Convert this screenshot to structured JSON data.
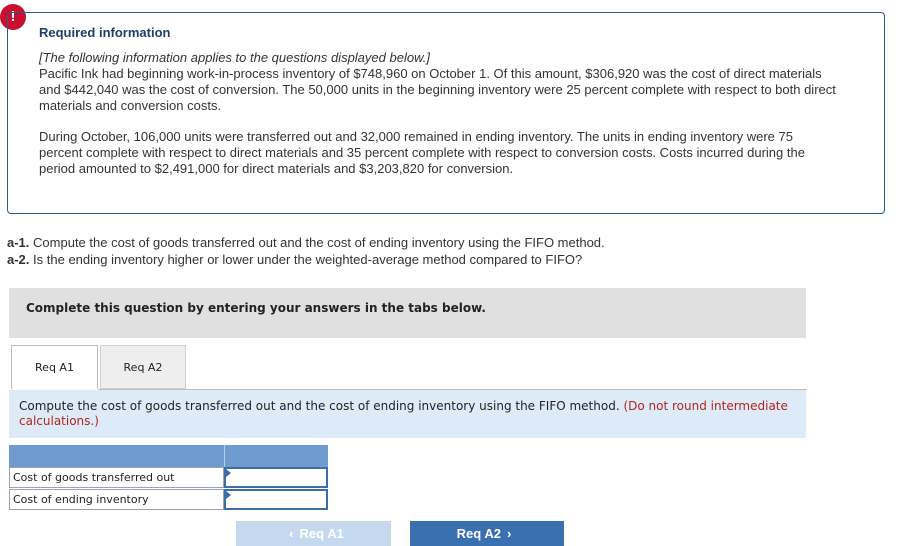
{
  "alert": {
    "icon": "!"
  },
  "info": {
    "title": "Required information",
    "intro_italic": "[The following information applies to the questions displayed below.]",
    "paragraph1": "Pacific Ink had beginning work-in-process inventory of $748,960 on October 1. Of this amount, $306,920 was the cost of direct materials and $442,040 was the cost of conversion. The 50,000 units in the beginning inventory were 25 percent complete with respect to both direct materials and conversion costs.",
    "paragraph2": "During October, 106,000 units were transferred out and 32,000 remained in ending inventory. The units in ending inventory were 75 percent complete with respect to direct materials and 35 percent complete with respect to conversion costs. Costs incurred during the period amounted to $2,491,000 for direct materials and $3,203,820 for conversion."
  },
  "questions": [
    {
      "label": "a-1.",
      "text": "Compute the cost of goods transferred out and the cost of ending inventory using the FIFO method."
    },
    {
      "label": "a-2.",
      "text": "Is the ending inventory higher or lower under the weighted-average method compared to FIFO?"
    }
  ],
  "instruction": "Complete this question by entering your answers in the tabs below.",
  "tabs": [
    {
      "label": "Req A1"
    },
    {
      "label": "Req A2"
    }
  ],
  "prompt": {
    "text": "Compute the cost of goods transferred out and the cost of ending inventory using the FIFO method.",
    "note": "(Do not round intermediate calculations.)"
  },
  "table": {
    "rows": [
      {
        "label": "Cost of goods transferred out",
        "value": ""
      },
      {
        "label": "Cost of ending inventory",
        "value": ""
      }
    ]
  },
  "nav": {
    "prev_label": "Req A1",
    "prev_icon": "‹",
    "next_label": "Req A2",
    "next_icon": "›"
  },
  "colors": {
    "accent": "#3a6fb0",
    "alert": "#c8102e",
    "note": "#b3261e",
    "prompt_bg": "#dcebf7"
  }
}
